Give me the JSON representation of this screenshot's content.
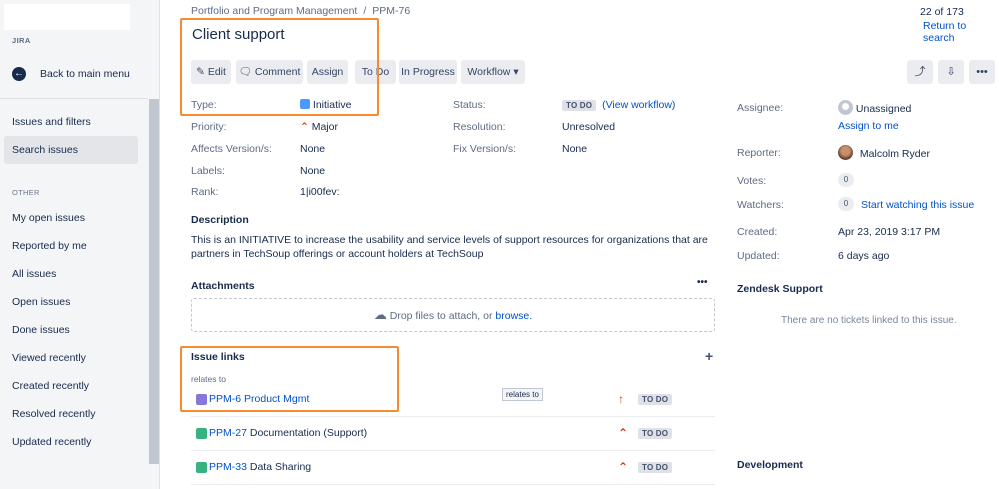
{
  "sidebar": {
    "app_label": "JIRA",
    "back_label": "Back to main menu",
    "issues_heading": "Issues and filters",
    "search_issues": "Search issues",
    "other_heading": "OTHER",
    "items": [
      {
        "label": "My open issues"
      },
      {
        "label": "Reported by me"
      },
      {
        "label": "All issues"
      },
      {
        "label": "Open issues"
      },
      {
        "label": "Done issues"
      },
      {
        "label": "Viewed recently"
      },
      {
        "label": "Created recently"
      },
      {
        "label": "Resolved recently"
      },
      {
        "label": "Updated recently"
      }
    ]
  },
  "header": {
    "breadcrumb_project": "Portfolio and Program Management",
    "breadcrumb_separator": "/",
    "breadcrumb_issue": "PPM-76",
    "title": "Client support",
    "pager": "22 of 173",
    "return_label": "Return to search"
  },
  "toolbar": {
    "edit": "Edit",
    "comment": "Comment",
    "assign": "Assign",
    "todo": "To Do",
    "in_progress": "In Progress",
    "workflow": "Workflow",
    "share_icon": "share-icon",
    "export_icon": "export-icon",
    "more": "•••"
  },
  "details": {
    "type_label": "Type:",
    "type_value": "Initiative",
    "priority_label": "Priority:",
    "priority_value": "Major",
    "affects_label": "Affects Version/s:",
    "affects_value": "None",
    "labels_label": "Labels:",
    "labels_value": "None",
    "rank_label": "Rank:",
    "rank_value": "1|i00fev:",
    "status_label": "Status:",
    "status_value": "TO DO",
    "view_workflow": "(View workflow)",
    "resolution_label": "Resolution:",
    "resolution_value": "Unresolved",
    "fix_label": "Fix Version/s:",
    "fix_value": "None"
  },
  "description": {
    "heading": "Description",
    "line1": "This is an INITIATIVE to increase the usability and service levels of support resources for organizations that are",
    "line2": "partners in TechSoup offerings or account holders at TechSoup"
  },
  "attachments": {
    "heading": "Attachments",
    "more": "•••",
    "drop_text": "Drop files to attach, or",
    "browse": "browse."
  },
  "issue_links": {
    "heading": "Issue links",
    "add": "+",
    "relation": "relates to",
    "tooltip": "relates to",
    "links": [
      {
        "key": "PPM-6",
        "summary": "Product Mgmt",
        "priority_glyph": "↑",
        "status": "TO DO",
        "icon_color": "#8777d9"
      },
      {
        "key": "PPM-27",
        "summary": "Documentation (Support)",
        "priority_glyph": "⌃",
        "status": "TO DO",
        "icon_color": "#36b37e"
      },
      {
        "key": "PPM-33",
        "summary": "Data Sharing",
        "priority_glyph": "⌃",
        "status": "TO DO",
        "icon_color": "#36b37e"
      }
    ]
  },
  "people": {
    "assignee_label": "Assignee:",
    "assignee_value": "Unassigned",
    "assign_to_me": "Assign to me",
    "reporter_label": "Reporter:",
    "reporter_value": "Malcolm Ryder",
    "votes_label": "Votes:",
    "votes_value": "0",
    "watchers_label": "Watchers:",
    "watchers_value": "0",
    "start_watching": "Start watching this issue",
    "created_label": "Created:",
    "created_value": "Apr 23, 2019 3:17 PM",
    "updated_label": "Updated:",
    "updated_value": "6 days ago"
  },
  "zendesk": {
    "heading": "Zendesk Support",
    "empty": "There are no tickets linked to this issue."
  },
  "development": {
    "heading": "Development"
  },
  "colors": {
    "highlight": "#f68b2f",
    "link": "#0052cc",
    "priority_major": "#de350b",
    "initiative": "#4c9aff"
  }
}
